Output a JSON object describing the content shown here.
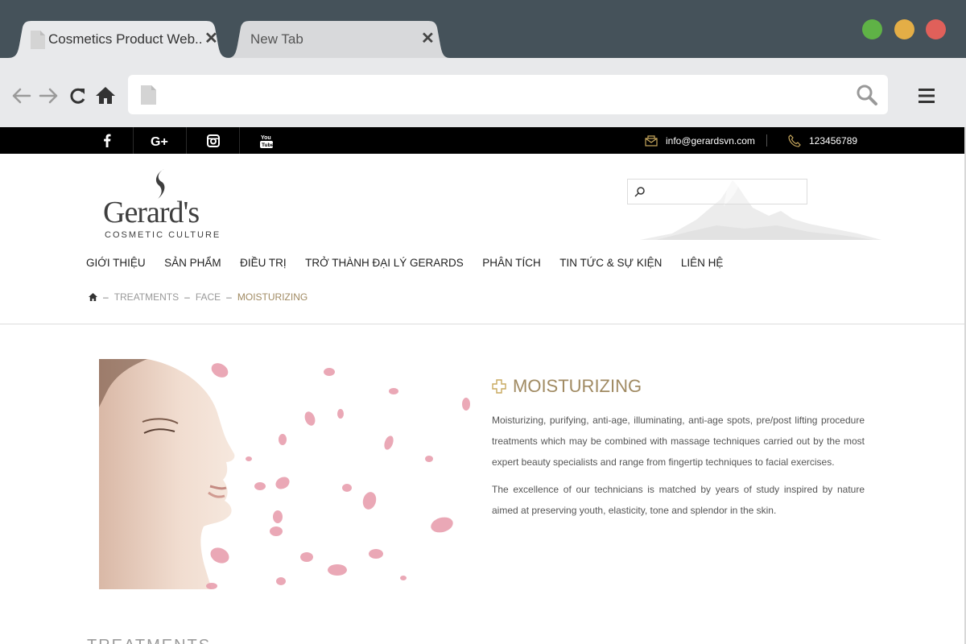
{
  "browser": {
    "tabs": [
      {
        "title": "Cosmetics Product Web..",
        "close": "✕",
        "active": true
      },
      {
        "title": "New Tab",
        "close": "✕",
        "active": false
      }
    ],
    "window_buttons": [
      {
        "name": "maximize",
        "color": "#5fb246"
      },
      {
        "name": "minimize",
        "color": "#e4ae46"
      },
      {
        "name": "close",
        "color": "#e0605a"
      }
    ],
    "address": {
      "url": ""
    }
  },
  "site": {
    "topbar": {
      "social": [
        "facebook-icon",
        "google-plus-icon",
        "instagram-icon",
        "youtube-icon"
      ],
      "email": "info@gerardsvn.com",
      "phone": "123456789"
    },
    "logo": {
      "name": "Gerard's",
      "tagline": "COSMETIC CULTURE"
    },
    "nav": [
      "GIỚI THIỆU",
      "SẢN PHẨM",
      "ĐIỀU TRỊ",
      "TRỞ THÀNH ĐẠI LÝ GERARDS",
      "PHÂN TÍCH",
      "TIN TỨC & SỰ KIỆN",
      "LIÊN HỆ"
    ],
    "breadcrumb": {
      "items": [
        "TREATMENTS",
        "FACE"
      ],
      "current": "MOISTURIZING",
      "separator": "–"
    },
    "product": {
      "title": "MOISTURIZING",
      "paragraphs": [
        "Moisturizing, purifying, anti-age, illuminating, anti-age spots, pre/post lifting procedure treatments which may be combined with massage techniques carried out by the most expert beauty specialists and range from fingertip techniques to facial exercises.",
        "The excellence of our technicians is matched by years of study inspired by nature aimed at preserving youth, elasticity, tone and splendor in the skin."
      ]
    },
    "next_section": "TREATMENTS",
    "colors": {
      "accent": "#a08a62",
      "topbar": "#000000",
      "chrome": "#45525a"
    }
  }
}
